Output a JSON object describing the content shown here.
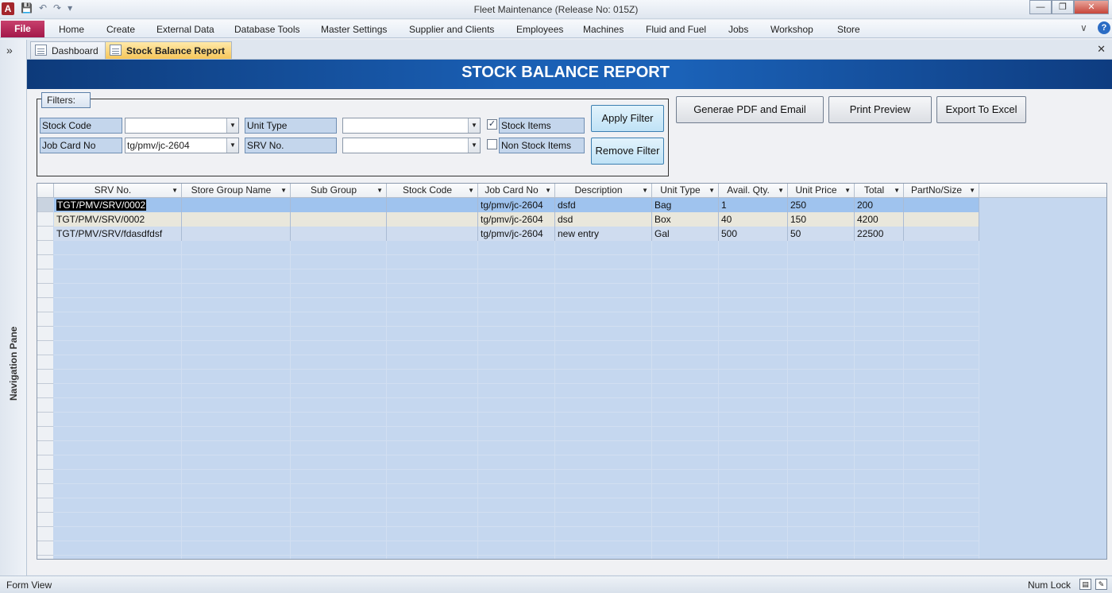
{
  "app": {
    "title": "Fleet Maintenance (Release No: 015Z)",
    "icon_letter": "A"
  },
  "ribbon": {
    "file_label": "File",
    "tabs": [
      "Home",
      "Create",
      "External Data",
      "Database Tools",
      "Master Settings",
      "Supplier and Clients",
      "Employees",
      "Machines",
      "Fluid and Fuel",
      "Jobs",
      "Workshop",
      "Store"
    ]
  },
  "nav": {
    "label": "Navigation Pane",
    "toggle": "»"
  },
  "doc_tabs": [
    {
      "label": "Dashboard",
      "active": false
    },
    {
      "label": "Stock Balance Report",
      "active": true
    }
  ],
  "report": {
    "title": "STOCK BALANCE REPORT"
  },
  "filters": {
    "legend": "Filters:",
    "stock_code_label": "Stock Code",
    "stock_code_value": "",
    "job_card_label": "Job Card No",
    "job_card_value": "tg/pmv/jc-2604",
    "unit_type_label": "Unit Type",
    "unit_type_value": "",
    "srv_label": "SRV No.",
    "srv_value": "",
    "stock_items_label": "Stock Items",
    "stock_items_checked": true,
    "non_stock_items_label": "Non Stock Items",
    "non_stock_items_checked": false,
    "apply_label": "Apply Filter",
    "remove_label": "Remove Filter"
  },
  "actions": {
    "pdf_label": "Generae PDF and Email",
    "preview_label": "Print Preview",
    "excel_label": "Export To Excel"
  },
  "grid": {
    "columns": [
      "SRV No.",
      "Store Group Name",
      "Sub Group",
      "Stock Code",
      "Job Card No",
      "Description",
      "Unit Type",
      "Avail. Qty.",
      "Unit Price",
      "Total",
      "PartNo/Size"
    ],
    "rows": [
      [
        "TGT/PMV/SRV/0002",
        "",
        "",
        "",
        "tg/pmv/jc-2604",
        "dsfd",
        "Bag",
        "1",
        "250",
        "200",
        ""
      ],
      [
        "TGT/PMV/SRV/0002",
        "",
        "",
        "",
        "tg/pmv/jc-2604",
        "dsd",
        "Box",
        "40",
        "150",
        "4200",
        ""
      ],
      [
        "TGT/PMV/SRV/fdasdfdsf",
        "",
        "",
        "",
        "tg/pmv/jc-2604",
        "new entry",
        "Gal",
        "500",
        "50",
        "22500",
        ""
      ]
    ],
    "row_colors": [
      "#9fc3ee",
      "#e9e7dc",
      "#cfdcef"
    ]
  },
  "status": {
    "left": "Form View",
    "right": "Num Lock"
  }
}
